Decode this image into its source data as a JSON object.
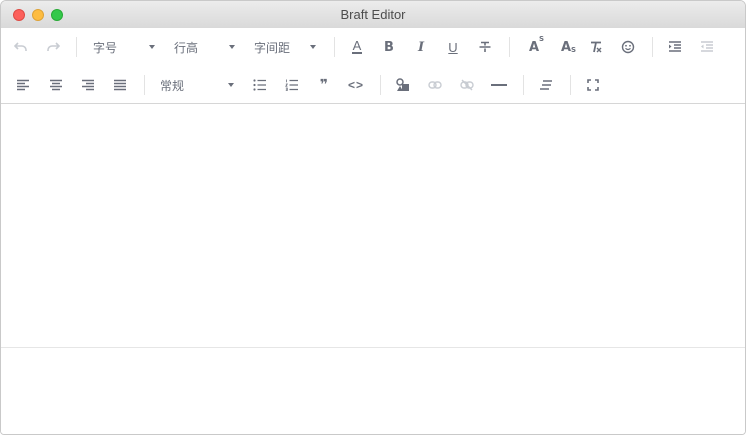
{
  "window": {
    "title": "Braft Editor"
  },
  "toolbar": {
    "font_size_label": "字号",
    "line_height_label": "行高",
    "letter_spacing_label": "字间距",
    "heading_label": "常规",
    "bold_glyph": "B",
    "italic_glyph": "I",
    "underline_glyph": "U",
    "color_glyph": "A",
    "superscript_glyph": "A",
    "subscript_glyph": "A",
    "superscript_mark": "S",
    "subscript_mark": "S",
    "quote_glyph": "❞",
    "code_glyph": "<>"
  },
  "colors": {
    "icon": "#6a6f7b",
    "icon_disabled": "#c8ccd2",
    "titlebar": "#e3e3e3"
  },
  "icons": {
    "undo": "undo-icon",
    "redo": "redo-icon",
    "clear": "clear-format-icon",
    "emoji": "emoji-icon",
    "indent": "indent-icon",
    "outdent": "outdent-icon",
    "align_left": "align-left-icon",
    "align_center": "align-center-icon",
    "align_right": "align-right-icon",
    "align_justify": "align-justify-icon",
    "ul": "bulleted-list-icon",
    "ol": "numbered-list-icon",
    "media": "media-icon",
    "link": "link-icon",
    "unlink": "unlink-icon",
    "hr": "horizontal-rule-icon",
    "remove_styles": "remove-styles-icon",
    "fullscreen": "fullscreen-icon"
  }
}
